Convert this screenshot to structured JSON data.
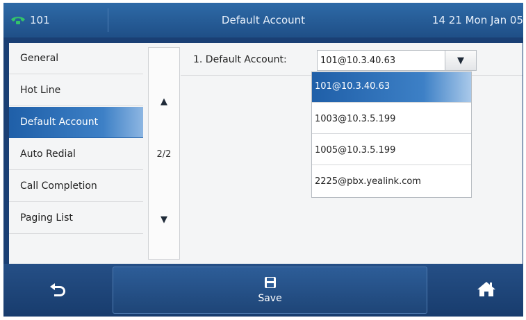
{
  "status_bar": {
    "line": "101",
    "title": "Default Account",
    "datetime": "14 21 Mon Jan 05"
  },
  "menu": {
    "items": [
      {
        "label": "General"
      },
      {
        "label": "Hot Line"
      },
      {
        "label": "Default Account",
        "active": true
      },
      {
        "label": "Auto Redial"
      },
      {
        "label": "Call Completion"
      },
      {
        "label": "Paging List"
      }
    ],
    "page_indicator": "2/2"
  },
  "setting": {
    "label": "1. Default Account:",
    "selected_value": "101@10.3.40.63",
    "options": [
      "101@10.3.40.63",
      "1003@10.3.5.199",
      "1005@10.3.5.199",
      "2225@pbx.yealink.com"
    ]
  },
  "bottom_bar": {
    "back_icon": "back-icon",
    "save_label": "Save",
    "home_icon": "home-icon"
  },
  "colors": {
    "accent": "#2f72bd",
    "bar": "#1f4f87"
  }
}
